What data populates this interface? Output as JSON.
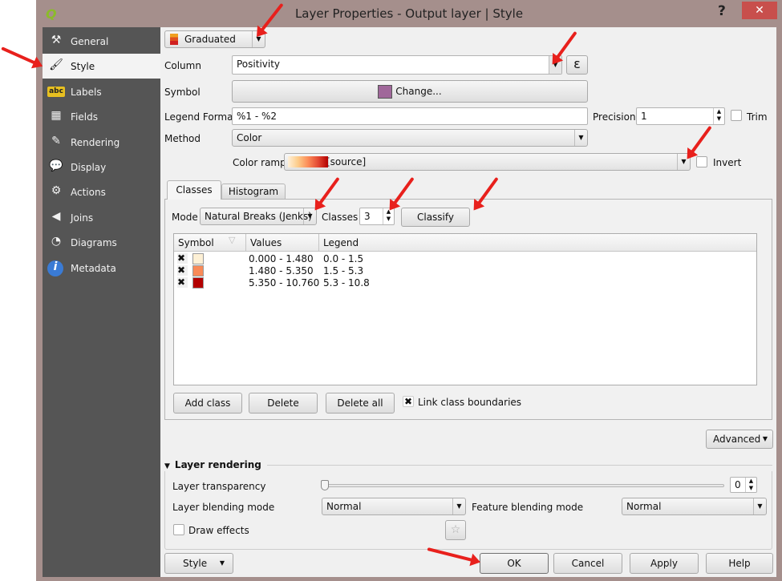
{
  "window": {
    "title": "Layer Properties - Output layer | Style",
    "help_label": "?",
    "close_label": "✕",
    "app_icon": "qgis-logo-icon"
  },
  "sidebar": {
    "items": [
      {
        "label": "General",
        "icon": "tools-icon",
        "glyph": "⚒"
      },
      {
        "label": "Style",
        "icon": "paintbrush-icon",
        "glyph": "🖌",
        "active": true
      },
      {
        "label": "Labels",
        "icon": "abc-label-icon",
        "glyph": "abc"
      },
      {
        "label": "Fields",
        "icon": "table-icon",
        "glyph": "▦"
      },
      {
        "label": "Rendering",
        "icon": "brush-icon",
        "glyph": "✎"
      },
      {
        "label": "Display",
        "icon": "speech-bubble-icon",
        "glyph": "💬"
      },
      {
        "label": "Actions",
        "icon": "gear-play-icon",
        "glyph": "⚙"
      },
      {
        "label": "Joins",
        "icon": "join-icon",
        "glyph": "◀"
      },
      {
        "label": "Diagrams",
        "icon": "pie-chart-icon",
        "glyph": "◔"
      },
      {
        "label": "Metadata",
        "icon": "info-icon",
        "glyph": "i"
      }
    ]
  },
  "renderer": {
    "value": "Graduated"
  },
  "form": {
    "column_label": "Column",
    "column_value": "Positivity",
    "expression_glyph": "ε",
    "symbol_label": "Symbol",
    "symbol_button": "Change...",
    "symbol_color": "#a0679a",
    "legend_format_label": "Legend Format",
    "legend_format_value": "%1 - %2",
    "precision_label": "Precision",
    "precision_value": "1",
    "trim_label": "Trim",
    "method_label": "Method",
    "method_value": "Color",
    "color_ramp_label": "Color ramp",
    "color_ramp_value": "[source]",
    "invert_label": "Invert",
    "ramp_colors": [
      "#fef0d9",
      "#fdcc8a",
      "#fc8d59",
      "#e34a33",
      "#b30000"
    ]
  },
  "tabs": [
    {
      "label": "Classes",
      "active": true
    },
    {
      "label": "Histogram"
    }
  ],
  "classes": {
    "mode_label": "Mode",
    "mode_value": "Natural Breaks (Jenks)",
    "classes_label": "Classes",
    "classes_value": "3",
    "classify_button": "Classify",
    "columns": [
      "Symbol",
      "Values",
      "Legend"
    ],
    "rows": [
      {
        "checked": "✖",
        "color": "#fdf0d5",
        "values": "0.000 - 1.480",
        "legend": "0.0 - 1.5"
      },
      {
        "checked": "✖",
        "color": "#f98a58",
        "values": "1.480 - 5.350",
        "legend": "1.5 - 5.3"
      },
      {
        "checked": "✖",
        "color": "#b30000",
        "values": "5.350 - 10.760",
        "legend": "5.3 - 10.8"
      }
    ],
    "add_class": "Add class",
    "delete": "Delete",
    "delete_all": "Delete all",
    "link_label": "Link class boundaries",
    "link_checked": "✖"
  },
  "advanced_button": "Advanced",
  "layer_rendering": {
    "header": "Layer rendering",
    "transparency_label": "Layer transparency",
    "transparency_value": "0",
    "blending_label": "Layer blending mode",
    "blending_value": "Normal",
    "feature_blending_label": "Feature blending mode",
    "feature_blending_value": "Normal",
    "draw_effects_label": "Draw effects"
  },
  "footer": {
    "style": "Style",
    "ok": "OK",
    "cancel": "Cancel",
    "apply": "Apply",
    "help": "Help"
  }
}
